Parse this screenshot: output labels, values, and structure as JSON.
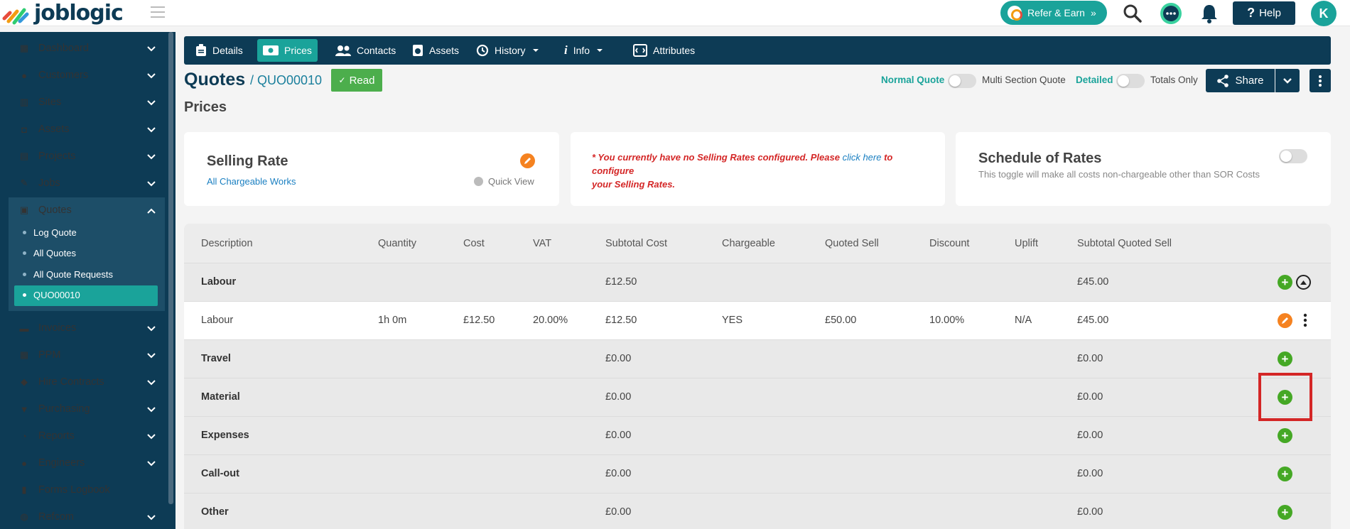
{
  "app": {
    "logo_text": "joblogic"
  },
  "topbar": {
    "refer_label": "Refer & Earn",
    "help_label": "Help",
    "avatar_initial": "K"
  },
  "sidebar": {
    "items": [
      {
        "label": "Dashboard",
        "icon": "dashboard-icon"
      },
      {
        "label": "Customers",
        "icon": "user-icon"
      },
      {
        "label": "Sites",
        "icon": "building-icon"
      },
      {
        "label": "Assets",
        "icon": "asset-icon"
      },
      {
        "label": "Projects",
        "icon": "projects-icon"
      },
      {
        "label": "Jobs",
        "icon": "wrench-icon"
      },
      {
        "label": "Quotes",
        "icon": "clipboard-icon"
      },
      {
        "label": "Invoices",
        "icon": "card-icon"
      },
      {
        "label": "PPM",
        "icon": "ppm-icon"
      },
      {
        "label": "Hire Contracts",
        "icon": "handshake-icon"
      },
      {
        "label": "Purchasing",
        "icon": "cart-icon"
      },
      {
        "label": "Reports",
        "icon": "pie-chart-icon"
      },
      {
        "label": "Engineers",
        "icon": "engineers-icon"
      },
      {
        "label": "Forms Logbook",
        "icon": "book-icon"
      },
      {
        "label": "Refcom",
        "icon": "refcom-icon"
      }
    ],
    "quotes_sub": [
      "Log Quote",
      "All Quotes",
      "All Quote Requests",
      "QUO00010"
    ]
  },
  "tabs": [
    {
      "label": "Details"
    },
    {
      "label": "Prices"
    },
    {
      "label": "Contacts"
    },
    {
      "label": "Assets"
    },
    {
      "label": "History"
    },
    {
      "label": "Info"
    },
    {
      "label": "Attributes"
    }
  ],
  "header": {
    "title": "Quotes",
    "crumb": "/ QUO00010",
    "badge": "Read",
    "section": "Prices",
    "normal_quote": "Normal Quote",
    "multi_section": "Multi Section Quote",
    "detailed": "Detailed",
    "totals_only": "Totals Only",
    "share": "Share"
  },
  "cards": {
    "selling": {
      "title": "Selling Rate",
      "link": "All Chargeable Works",
      "quick_view": "Quick View"
    },
    "warning": {
      "pre": "* You currently have no Selling Rates configured. Please ",
      "link": "click here",
      "post": " to configure",
      "line2": "your Selling Rates."
    },
    "schedule": {
      "title": "Schedule of Rates",
      "desc": "This toggle will make all costs non-chargeable other than SOR Costs"
    }
  },
  "table": {
    "headers": [
      "Description",
      "Quantity",
      "Cost",
      "VAT",
      "Subtotal Cost",
      "Chargeable",
      "Quoted Sell",
      "Discount",
      "Uplift",
      "Subtotal Quoted Sell"
    ],
    "rows": [
      {
        "description": "Labour",
        "subtotal_cost": "£12.50",
        "subtotal_sell": "£45.00"
      },
      {
        "description": "Labour",
        "quantity": "1h 0m",
        "cost": "£12.50",
        "vat": "20.00%",
        "subtotal_cost": "£12.50",
        "chargeable": "YES",
        "quoted_sell": "£50.00",
        "discount": "10.00%",
        "uplift": "N/A",
        "subtotal_sell": "£45.00"
      },
      {
        "description": "Travel",
        "subtotal_cost": "£0.00",
        "subtotal_sell": "£0.00"
      },
      {
        "description": "Material",
        "subtotal_cost": "£0.00",
        "subtotal_sell": "£0.00"
      },
      {
        "description": "Expenses",
        "subtotal_cost": "£0.00",
        "subtotal_sell": "£0.00"
      },
      {
        "description": "Call-out",
        "subtotal_cost": "£0.00",
        "subtotal_sell": "£0.00"
      },
      {
        "description": "Other",
        "subtotal_cost": "£0.00",
        "subtotal_sell": "£0.00"
      }
    ]
  },
  "colors": {
    "navy": "#0d3b55",
    "teal": "#1aa39a",
    "green": "#45a825",
    "orange": "#f58220",
    "highlight": "#d42626"
  }
}
